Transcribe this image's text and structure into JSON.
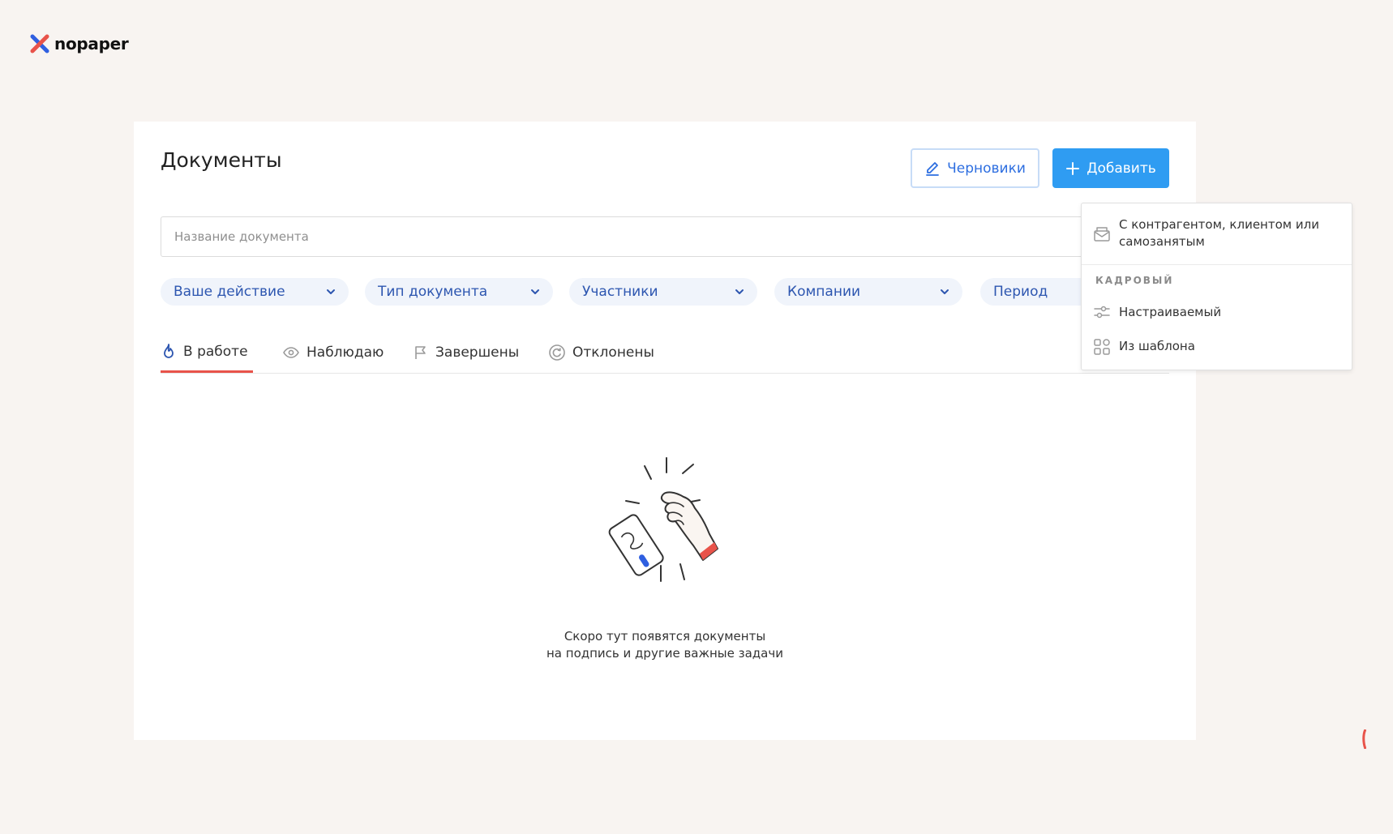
{
  "brand": {
    "name": "nopaper",
    "colors": {
      "blue": "#2f5fe0",
      "red": "#e8534a"
    }
  },
  "page": {
    "title": "Документы"
  },
  "toolbar": {
    "drafts_label": "Черновики",
    "drafts_icon": "pencil-icon",
    "add_label": "Добавить",
    "add_icon": "plus-icon",
    "accent": "#2f9cf2"
  },
  "search": {
    "placeholder": "Название документа",
    "value": ""
  },
  "filters": [
    {
      "label": "Ваше действие"
    },
    {
      "label": "Тип документа"
    },
    {
      "label": "Участники"
    },
    {
      "label": "Компании"
    },
    {
      "label": "Период"
    }
  ],
  "tabs": [
    {
      "label": "В работе",
      "icon": "flame-icon",
      "active": true
    },
    {
      "label": "Наблюдаю",
      "icon": "eye-icon",
      "active": false
    },
    {
      "label": "Завершены",
      "icon": "flag-icon",
      "active": false
    },
    {
      "label": "Отклонены",
      "icon": "rotate-icon",
      "active": false
    }
  ],
  "empty_state": {
    "line1": "Скоро тут появятся документы",
    "line2": "на подпись и другие важные задачи"
  },
  "add_menu": {
    "items": [
      {
        "label": "С контрагентом, клиентом или самозанятым",
        "icon": "envelope-icon"
      }
    ],
    "group_label": "КАДРОВЫЙ",
    "group_items": [
      {
        "label": "Настраиваемый",
        "icon": "sliders-icon"
      },
      {
        "label": "Из шаблона",
        "icon": "grid-icon"
      }
    ]
  }
}
